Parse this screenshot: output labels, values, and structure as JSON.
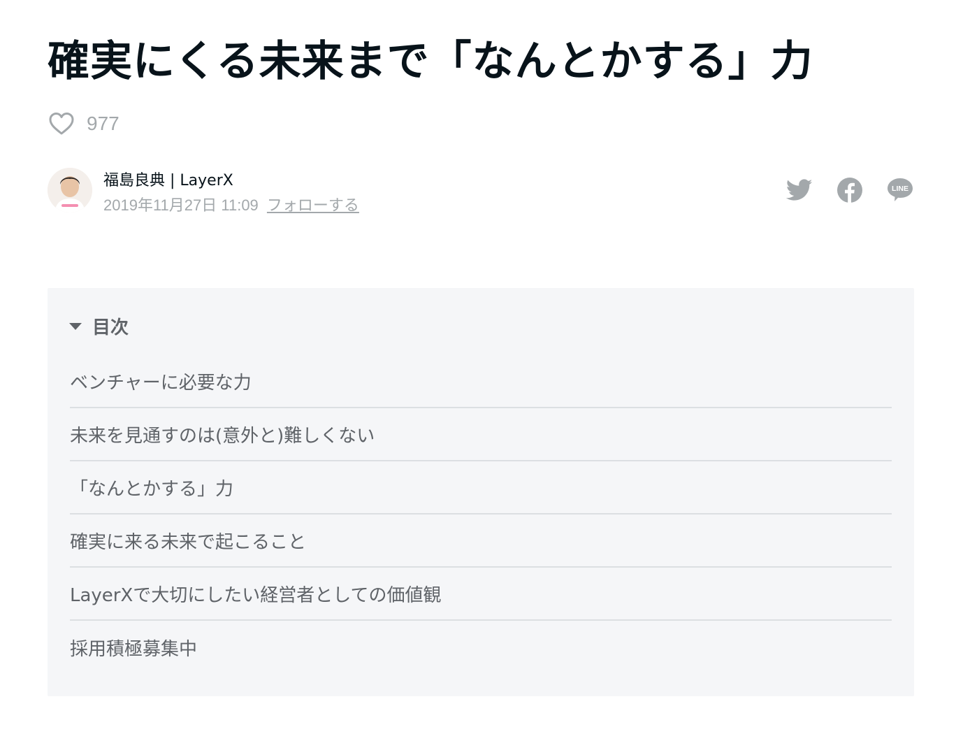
{
  "article": {
    "title": "確実にくる未来まで「なんとかする」力",
    "like_count": "977",
    "author_name": "福島良典 | LayerX",
    "published_at": "2019年11月27日 11:09",
    "follow_label": "フォローする"
  },
  "share": {
    "icons": [
      "twitter-icon",
      "facebook-icon",
      "line-icon"
    ],
    "line_text": "LINE",
    "icon_color": "#a3a8ab"
  },
  "toc": {
    "title": "目次",
    "items": [
      "ベンチャーに必要な力",
      "未来を見通すのは(意外と)難しくない",
      "「なんとかする」力",
      "確実に来る未来で起こること",
      "LayerXで大切にしたい経営者としての価値観",
      "採用積極募集中"
    ]
  },
  "colors": {
    "title_text": "#08131a",
    "muted_text": "#a3a8ab",
    "toc_bg": "#f5f6f8",
    "toc_text": "#5f6368",
    "divider": "#dcdfe2",
    "avatar_accent": "#f48fb1"
  }
}
